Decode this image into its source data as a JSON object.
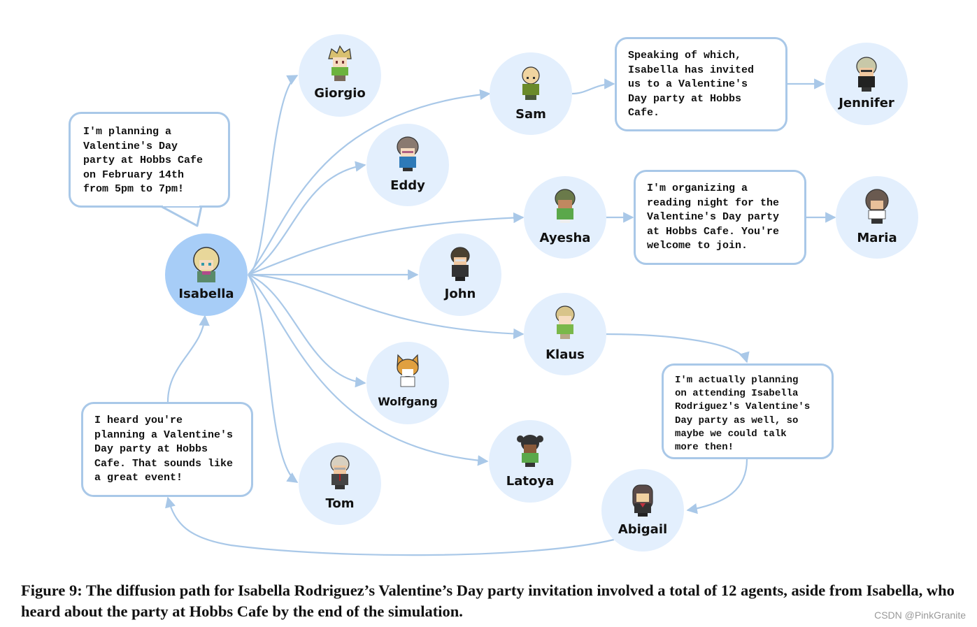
{
  "figure": {
    "caption": "Figure 9: The diffusion path for Isabella Rodriguez’s Valentine’s Day party invitation involved a total of 12 agents, aside from Isabella, who heard about the party at Hobbs Cafe by the end of the simulation.",
    "watermark": "CSDN @PinkGranite",
    "colors": {
      "edge": "#a9c8e8",
      "node_fill": "#e3effd",
      "root_fill": "#a7cdf7",
      "bubble_border": "#a9c8e8"
    }
  },
  "nodes": {
    "isabella": {
      "name": "Isabella",
      "avatar": "blonde-girl-avatar",
      "root": true
    },
    "giorgio": {
      "name": "Giorgio",
      "avatar": "spiky-hair-boy-avatar"
    },
    "sam": {
      "name": "Sam",
      "avatar": "bald-man-avatar"
    },
    "jennifer": {
      "name": "Jennifer",
      "avatar": "gray-hair-woman-avatar"
    },
    "eddy": {
      "name": "Eddy",
      "avatar": "glasses-boy-avatar"
    },
    "ayesha": {
      "name": "Ayesha",
      "avatar": "girl-avatar"
    },
    "maria": {
      "name": "Maria",
      "avatar": "curly-hair-woman-avatar"
    },
    "john": {
      "name": "John",
      "avatar": "suit-man-avatar"
    },
    "klaus": {
      "name": "Klaus",
      "avatar": "blond-boy-avatar"
    },
    "wolfgang": {
      "name": "Wolfgang",
      "avatar": "cat-costume-avatar"
    },
    "latoya": {
      "name": "Latoya",
      "avatar": "pigtails-girl-avatar"
    },
    "tom": {
      "name": "Tom",
      "avatar": "old-man-avatar"
    },
    "abigail": {
      "name": "Abigail",
      "avatar": "dark-hair-girl-avatar"
    }
  },
  "bubbles": {
    "isabella": "I'm planning a\nValentine's Day\nparty at Hobbs Cafe\non February 14th\nfrom 5pm to 7pm!",
    "sam": "Speaking of which,\nIsabella has invited\nus to a Valentine's\nDay party at Hobbs\nCafe.",
    "ayesha": "I'm organizing a\nreading night for the\nValentine's Day party\nat Hobbs Cafe. You're\nwelcome to join.",
    "klaus": "I'm actually planning\non attending Isabella\nRodriguez's Valentine's\nDay party as well, so\nmaybe we could talk\nmore then!",
    "abigail": "I heard you're\nplanning a Valentine's\nDay party at Hobbs\nCafe. That sounds like\na great event!"
  },
  "edges": [
    [
      "isabella",
      "giorgio"
    ],
    [
      "isabella",
      "sam"
    ],
    [
      "isabella",
      "eddy"
    ],
    [
      "isabella",
      "ayesha"
    ],
    [
      "isabella",
      "john"
    ],
    [
      "isabella",
      "klaus"
    ],
    [
      "isabella",
      "wolfgang"
    ],
    [
      "isabella",
      "latoya"
    ],
    [
      "isabella",
      "tom"
    ],
    [
      "sam",
      "jennifer"
    ],
    [
      "ayesha",
      "maria"
    ],
    [
      "klaus",
      "abigail"
    ],
    [
      "abigail",
      "isabella"
    ]
  ]
}
